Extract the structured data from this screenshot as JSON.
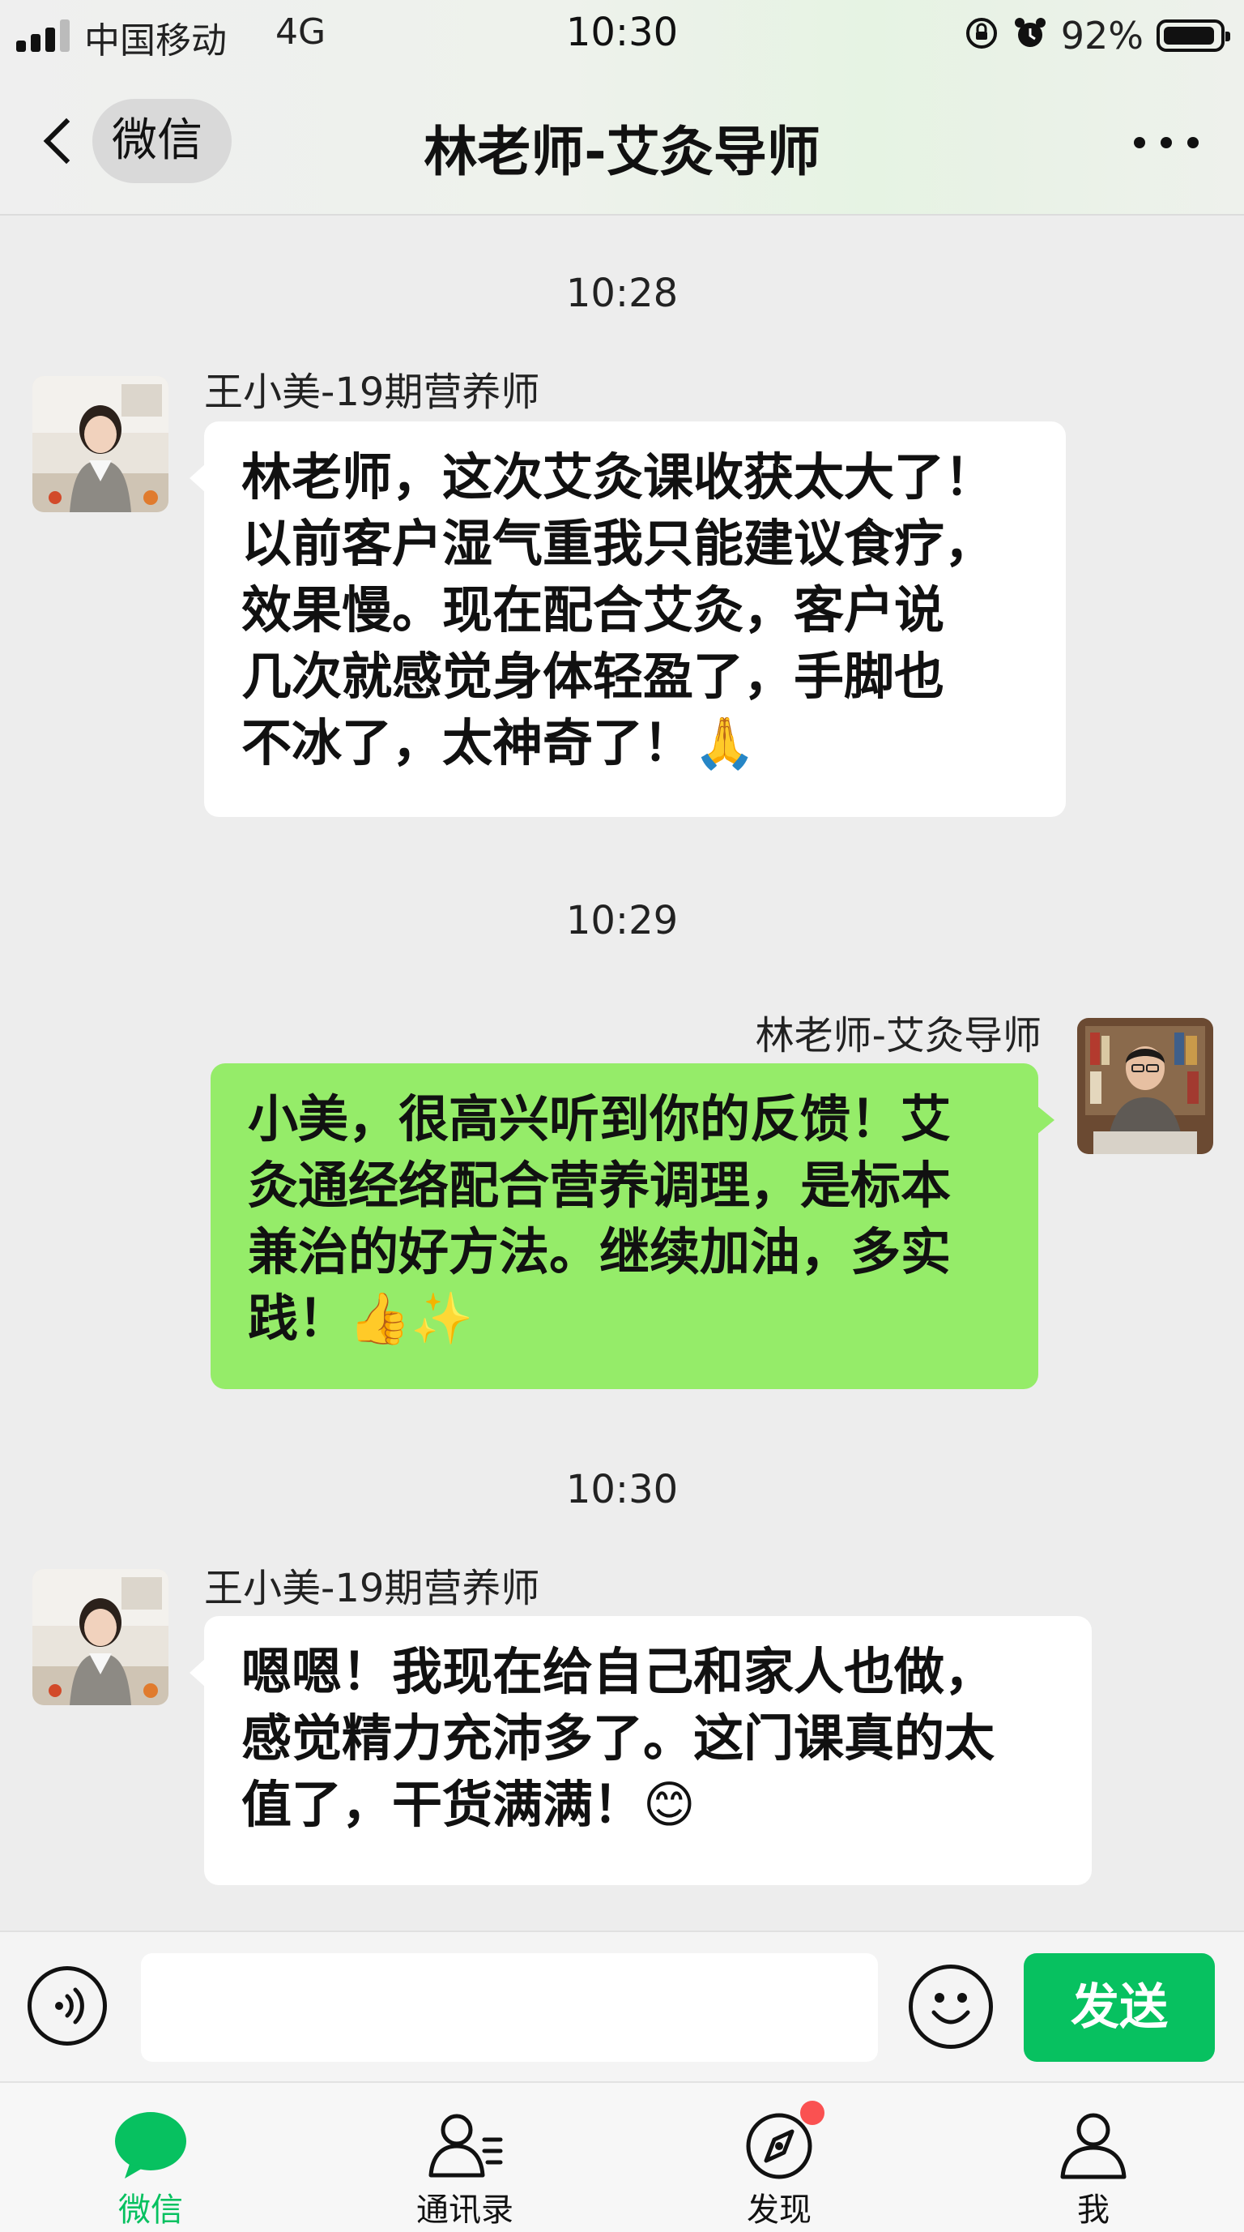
{
  "status_bar": {
    "carrier": "中国移动",
    "network": "4G",
    "time": "10:30",
    "battery": "92%",
    "battery_level": 0.92,
    "icons": [
      "signal-icon",
      "orientation-lock-icon",
      "alarm-icon",
      "battery-icon"
    ]
  },
  "nav": {
    "back_label": "微信",
    "title": "林老师-艾灸导师",
    "more_icon": "more-dots-icon"
  },
  "messages": [
    {
      "time": "10:28",
      "direction": "incoming",
      "sender": "王小美-19期营养师",
      "lines": [
        "林老师，这次艾灸课收获太大了！",
        "以前客户湿气重我只能建议食疗，",
        "效果慢。现在配合艾灸，客户说",
        "几次就感觉身体轻盈了，手脚也",
        "不冰了，太神奇了！🙏"
      ]
    },
    {
      "time": "10:29",
      "direction": "outgoing",
      "sender": "林老师-艾灸导师",
      "lines": [
        "小美，很高兴听到你的反馈！艾",
        "灸通经络配合营养调理，是标本",
        "兼治的好方法。继续加油，多实",
        "践！👍✨"
      ]
    },
    {
      "time": "10:30",
      "direction": "incoming",
      "sender": "王小美-19期营养师",
      "lines": [
        "嗯嗯！我现在给自己和家人也做，",
        "感觉精力充沛多了。这门课真的太",
        "值了，干货满满！😊"
      ]
    }
  ],
  "input": {
    "value": "",
    "placeholder": "",
    "send_label": "发送"
  },
  "tabs": [
    {
      "label": "微信",
      "icon": "chat-bubble-icon",
      "active": true
    },
    {
      "label": "通讯录",
      "icon": "contacts-icon",
      "active": false
    },
    {
      "label": "发现",
      "icon": "compass-icon",
      "active": false,
      "badge_dot": true
    },
    {
      "label": "我",
      "icon": "person-icon",
      "active": false
    }
  ],
  "colors": {
    "wechat_green": "#07c160",
    "outgoing_bubble": "#95ec69",
    "incoming_bubble": "#ffffff",
    "chat_background": "#ededed",
    "badge_red": "#fa5151"
  }
}
